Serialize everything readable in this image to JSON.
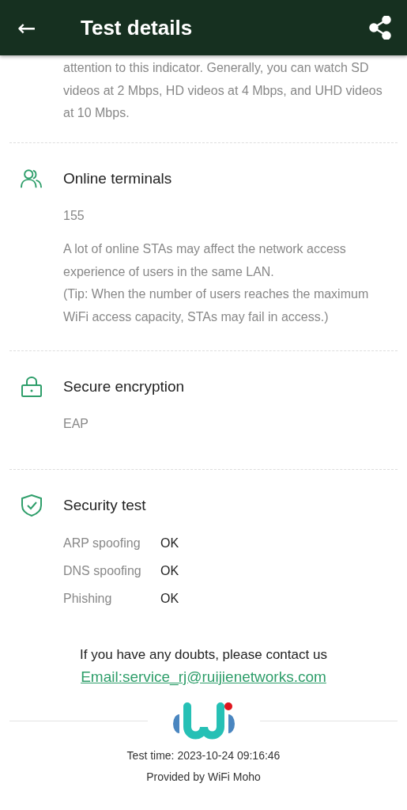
{
  "header": {
    "back": "←",
    "title": "Test details"
  },
  "intro": [
    "attention to this indicator. Generally, you can watch SD videos at 2 Mbps, HD videos at 4 Mbps, and UHD videos at 10 Mbps."
  ],
  "sections": [
    {
      "title": "Online terminals",
      "kind": "text",
      "paragraphs": [
        "155",
        "A lot of online STAs may affect the network access experience of users in the same LAN.",
        "(Tip: When the number of users reaches the maximum WiFi access capacity, STAs may fail in access.)"
      ]
    },
    {
      "title": "Secure encryption",
      "kind": "text",
      "paragraphs": [
        "EAP"
      ]
    },
    {
      "title": "Security test",
      "kind": "checks",
      "checks": [
        {
          "name": "ARP spoofing",
          "result": "OK"
        },
        {
          "name": "DNS spoofing",
          "result": "OK"
        },
        {
          "name": "Phishing",
          "result": "OK"
        }
      ]
    }
  ],
  "contact": {
    "text": "If you have any doubts, please contact us",
    "email": "Email:service_rj@ruijienetworks.com"
  },
  "footer": {
    "test_time": "Test time: 2023-10-24 09:16:46",
    "provider": "Provided by WiFi Moho"
  }
}
